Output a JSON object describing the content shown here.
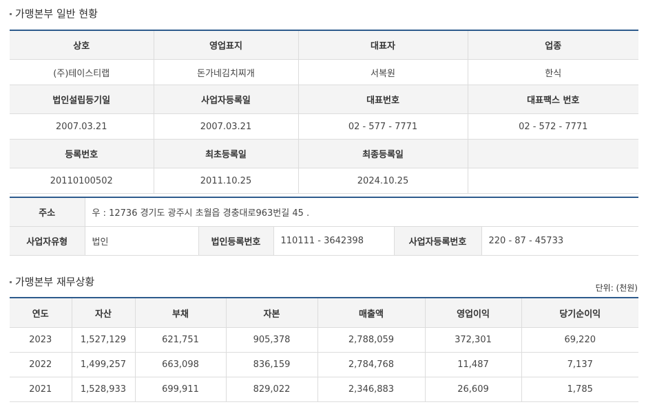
{
  "section1": {
    "title": "가맹본부 일반 현황",
    "row1_headers": [
      "상호",
      "영업표지",
      "대표자",
      "업종"
    ],
    "row1_values": [
      "(주)테이스티랩",
      "돈가네김치찌개",
      "서복원",
      "한식"
    ],
    "row2_headers": [
      "법인설립등기일",
      "사업자등록일",
      "대표번호",
      "대표팩스 번호"
    ],
    "row2_values": [
      "2007.03.21",
      "2007.03.21",
      "02 - 577 - 7771",
      "02 - 572 - 7771"
    ],
    "row3_headers": [
      "등록번호",
      "최초등록일",
      "최종등록일",
      ""
    ],
    "row3_values": [
      "20110100502",
      "2011.10.25",
      "2024.10.25",
      ""
    ]
  },
  "section2": {
    "address_label": "주소",
    "address_value": "우 : 12736 경기도 광주시 초월읍 경충대로963번길 45 .",
    "biz_type_label": "사업자유형",
    "biz_type_value": "법인",
    "corp_no_label": "법인등록번호",
    "corp_no_value": "110111 - 3642398",
    "biz_no_label": "사업자등록번호",
    "biz_no_value": "220 - 87 - 45733"
  },
  "section3": {
    "title": "가맹본부 재무상황",
    "unit": "단위: (천원)",
    "headers": [
      "연도",
      "자산",
      "부채",
      "자본",
      "매출액",
      "영업이익",
      "당기순이익"
    ],
    "rows": [
      [
        "2023",
        "1,527,129",
        "621,751",
        "905,378",
        "2,788,059",
        "372,301",
        "69,220"
      ],
      [
        "2022",
        "1,499,257",
        "663,098",
        "836,159",
        "2,784,768",
        "11,487",
        "7,137"
      ],
      [
        "2021",
        "1,528,933",
        "699,911",
        "829,022",
        "2,346,883",
        "26,609",
        "1,785"
      ]
    ]
  }
}
